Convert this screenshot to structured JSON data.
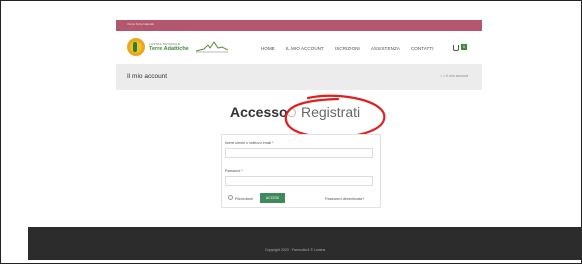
{
  "topbar": {
    "text": "Vivi le Terre Naturali"
  },
  "logo": {
    "line1": "LASTRA NATURALE",
    "line2": "Terre Adattiche"
  },
  "nav": {
    "items": [
      "HOME",
      "IL MIO ACCOUNT",
      "ISCRIZIONI",
      "ASSISTENZA",
      "CONTATTI"
    ],
    "cart_count": "0"
  },
  "titlebar": {
    "title": "Il mio account",
    "breadcrumb": "⌂ > Il mio account"
  },
  "main": {
    "login_title": "Accesso",
    "register_title": "Registrati"
  },
  "form": {
    "username_label": "Nome utente o indirizzo email *",
    "password_label": "Password *",
    "remember_label": "Ricordami",
    "login_button": "ACCEDI",
    "lost_password": "Password dimenticata?"
  },
  "footer": {
    "copyright": "Copyright 2023 · Farmodia.it © Lumina"
  },
  "colors": {
    "topbar": "#b5566f",
    "accent": "#3f8a5c",
    "footer": "#2c2c2c",
    "annotation": "#e02020"
  }
}
